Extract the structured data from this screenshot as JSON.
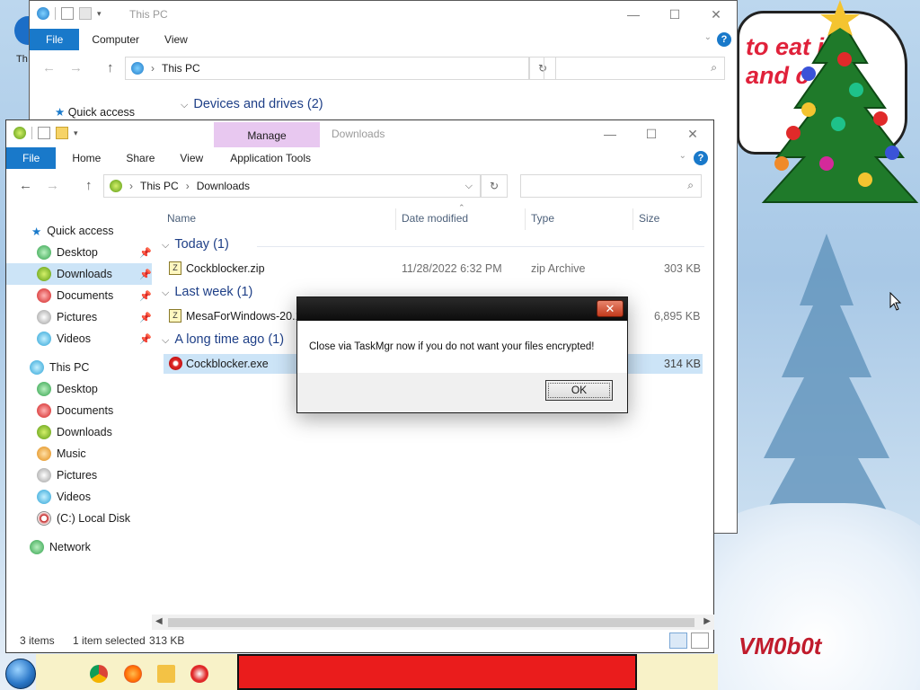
{
  "desktop": {
    "speech_text": "to eat it and c can",
    "watermark": "VM0b0t",
    "partial_icon_label": "Th",
    "colors": {
      "dialog_close": "#c23a1c",
      "file_tab": "#1979ca",
      "selection": "#cce4f7",
      "manage_tab": "#e8c8f0"
    }
  },
  "back_window": {
    "title": "This PC",
    "tabs": [
      "File",
      "Computer",
      "View"
    ],
    "address_path": [
      "This PC"
    ],
    "sidebar_first": "Quick access",
    "group_header": "Devices and drives (2)"
  },
  "front_window": {
    "title": "Downloads",
    "context_tab": "Manage",
    "tabs": [
      "File",
      "Home",
      "Share",
      "View",
      "Application Tools"
    ],
    "address_path": [
      "This PC",
      "Downloads"
    ],
    "columns": [
      "Name",
      "Date modified",
      "Type",
      "Size"
    ],
    "sidebar": [
      {
        "label": "Quick access",
        "icon": "star-icon",
        "level": 0,
        "pinned": false,
        "selected": false
      },
      {
        "label": "Desktop",
        "icon": "desktop-icon",
        "level": 1,
        "pinned": true,
        "selected": false
      },
      {
        "label": "Downloads",
        "icon": "downloads-icon",
        "level": 1,
        "pinned": true,
        "selected": true
      },
      {
        "label": "Documents",
        "icon": "documents-icon",
        "level": 1,
        "pinned": true,
        "selected": false
      },
      {
        "label": "Pictures",
        "icon": "pictures-icon",
        "level": 1,
        "pinned": true,
        "selected": false
      },
      {
        "label": "Videos",
        "icon": "videos-icon",
        "level": 1,
        "pinned": true,
        "selected": false
      },
      {
        "label": "This PC",
        "icon": "this-pc-icon",
        "level": 0,
        "pinned": false,
        "selected": false
      },
      {
        "label": "Desktop",
        "icon": "desktop-icon",
        "level": 1,
        "pinned": false,
        "selected": false
      },
      {
        "label": "Documents",
        "icon": "documents-icon",
        "level": 1,
        "pinned": false,
        "selected": false
      },
      {
        "label": "Downloads",
        "icon": "downloads-icon",
        "level": 1,
        "pinned": false,
        "selected": false
      },
      {
        "label": "Music",
        "icon": "music-icon",
        "level": 1,
        "pinned": false,
        "selected": false
      },
      {
        "label": "Pictures",
        "icon": "pictures-icon",
        "level": 1,
        "pinned": false,
        "selected": false
      },
      {
        "label": "Videos",
        "icon": "videos-icon",
        "level": 1,
        "pinned": false,
        "selected": false
      },
      {
        "label": "(C:) Local Disk",
        "icon": "disk-icon",
        "level": 1,
        "pinned": false,
        "selected": false
      },
      {
        "label": "Network",
        "icon": "network-icon",
        "level": 0,
        "pinned": false,
        "selected": false
      }
    ],
    "groups": [
      {
        "header": "Today (1)",
        "files": [
          {
            "name": "Cockblocker.zip",
            "date": "11/28/2022 6:32 PM",
            "type": "zip Archive",
            "size": "303 KB",
            "icon": "zip-icon",
            "selected": false
          }
        ]
      },
      {
        "header": "Last week (1)",
        "files": [
          {
            "name": "MesaForWindows-20.1.",
            "date": "",
            "type": "",
            "size": "6,895 KB",
            "icon": "zip-icon",
            "selected": false
          }
        ]
      },
      {
        "header": "A long time ago (1)",
        "files": [
          {
            "name": "Cockblocker.exe",
            "date": "",
            "type": "",
            "size": "314 KB",
            "icon": "exe-icon",
            "selected": true
          }
        ]
      }
    ],
    "status": {
      "items": "3 items",
      "selected": "1 item selected",
      "size": "313 KB"
    }
  },
  "dialog": {
    "close_glyph": "✕",
    "message": "Close via TaskMgr now if you do not want your files encrypted!",
    "ok_label": "OK"
  }
}
